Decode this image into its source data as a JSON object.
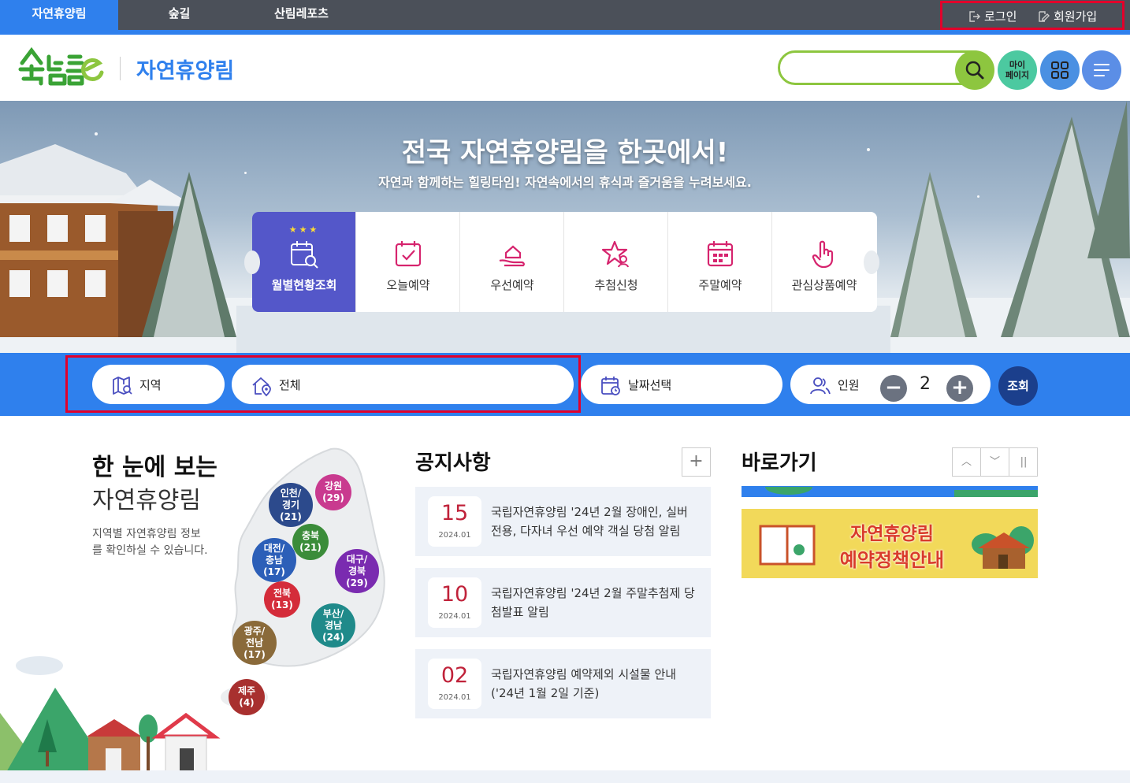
{
  "topbar": {
    "tabs": [
      {
        "label": "자연휴양림",
        "active": true
      },
      {
        "label": "숲길",
        "active": false
      },
      {
        "label": "산림레포츠",
        "active": false
      }
    ],
    "login": "로그인",
    "signup": "회원가입"
  },
  "header": {
    "site_title": "자연휴양림",
    "search_placeholder": "",
    "mypage_line1": "마이",
    "mypage_line2": "페이지"
  },
  "hero": {
    "title": "전국 자연휴양림을 한곳에서!",
    "subtitle": "자연과 함께하는 힐링타임! 자연속에서의 휴식과 즐거움을 누려보세요.",
    "stars": "★★★",
    "tiles": [
      {
        "label": "월별현황조회",
        "icon": "calendar-search-icon",
        "active": true
      },
      {
        "label": "오늘예약",
        "icon": "calendar-check-icon",
        "active": false
      },
      {
        "label": "우선예약",
        "icon": "hand-house-icon",
        "active": false
      },
      {
        "label": "추첨신청",
        "icon": "star-person-icon",
        "active": false
      },
      {
        "label": "주말예약",
        "icon": "calendar-grid-icon",
        "active": false
      },
      {
        "label": "관심상품예약",
        "icon": "pointer-hand-icon",
        "active": false
      }
    ]
  },
  "search": {
    "region_label": "지역",
    "region_value": "전체",
    "date_label": "날짜선택",
    "people_label": "인원",
    "people_count": "2",
    "minus": "−",
    "plus": "+",
    "query_button": "조회"
  },
  "map": {
    "title_bold": "한 눈에 보는",
    "title_light": "자연휴양림",
    "description": "지역별 자연휴양림 정보를 확인하실 수 있습니다.",
    "regions": [
      {
        "line1": "인천/",
        "line2": "경기",
        "count": "(21)",
        "color": "#2c4a8c"
      },
      {
        "line1": "강원",
        "line2": "",
        "count": "(29)",
        "color": "#c93a8f"
      },
      {
        "line1": "충북",
        "line2": "",
        "count": "(21)",
        "color": "#3b8c3a"
      },
      {
        "line1": "대전/",
        "line2": "충남",
        "count": "(17)",
        "color": "#2c5fb8"
      },
      {
        "line1": "대구/",
        "line2": "경북",
        "count": "(29)",
        "color": "#7a2bb0"
      },
      {
        "line1": "전북",
        "line2": "",
        "count": "(13)",
        "color": "#d42c3a"
      },
      {
        "line1": "부산/",
        "line2": "경남",
        "count": "(24)",
        "color": "#1f8a8a"
      },
      {
        "line1": "광주/",
        "line2": "전남",
        "count": "(17)",
        "color": "#8a6a3a"
      },
      {
        "line1": "제주",
        "line2": "",
        "count": "(4)",
        "color": "#a8302f"
      }
    ]
  },
  "notices": {
    "title": "공지사항",
    "more": "+",
    "items": [
      {
        "day": "15",
        "ym": "2024.01",
        "text": "국립자연휴양림 '24년 2월 장애인, 실버 전용, 다자녀 우선 예약 객실 당첨 알림"
      },
      {
        "day": "10",
        "ym": "2024.01",
        "text": "국립자연휴양림 '24년 2월 주말추첨제 당첨발표 알림"
      },
      {
        "day": "02",
        "ym": "2024.01",
        "text": "국립자연휴양림 예약제외 시설물 안내 ('24년 1월 2일 기준)"
      }
    ]
  },
  "quick": {
    "title": "바로가기",
    "up": "︿",
    "down": "﹀",
    "pause": "||",
    "banner_line1": "자연휴양림",
    "banner_line2": "예약정책안내"
  },
  "colors": {
    "accent": "#2f80ed",
    "topbar": "#4b5059",
    "green": "#8dc63f",
    "tile_active": "#5457c9",
    "highlight_red": "#e2002b"
  }
}
